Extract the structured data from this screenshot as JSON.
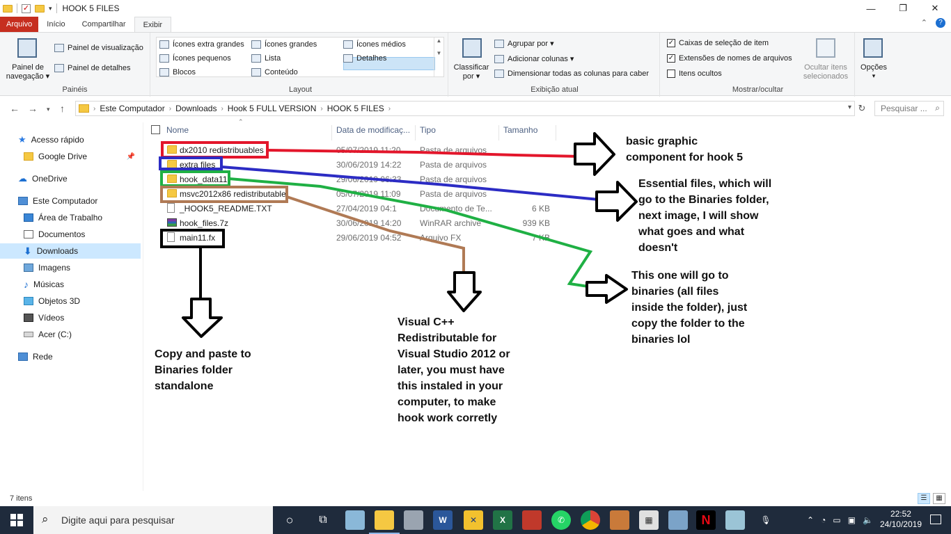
{
  "window": {
    "title": "HOOK 5 FILES",
    "controls": [
      "—",
      "❐",
      "✕"
    ]
  },
  "ribbon_tabs": [
    "Arquivo",
    "Início",
    "Compartilhar",
    "Exibir"
  ],
  "ribbon": {
    "paineis": {
      "label": "Painéis",
      "nav_pane": "Painel de\nnavegação ▾",
      "preview": "Painel de visualização",
      "details": "Painel de detalhes"
    },
    "layout": {
      "label": "Layout",
      "items": [
        "Ícones extra grandes",
        "Ícones grandes",
        "Ícones médios",
        "Ícones pequenos",
        "Lista",
        "Detalhes",
        "Blocos",
        "Conteúdo"
      ],
      "selected": "Detalhes"
    },
    "current_view": {
      "label": "Exibição atual",
      "sort": "Classificar\npor ▾",
      "group_by": "Agrupar por ▾",
      "add_columns": "Adicionar colunas ▾",
      "size_columns": "Dimensionar todas as colunas para caber"
    },
    "show_hide": {
      "label": "Mostrar/ocultar",
      "item_checkboxes": "Caixas de seleção de item",
      "extensions": "Extensões de nomes de arquivos",
      "hidden_items": "Itens ocultos",
      "hide_selected": "Ocultar itens\nselecionados",
      "options": "Opções"
    }
  },
  "address": {
    "crumbs": [
      "Este Computador",
      "Downloads",
      "Hook 5 FULL VERSION",
      "HOOK 5 FILES"
    ],
    "search_placeholder": "Pesquisar ..."
  },
  "nav_pane": {
    "items": [
      {
        "label": "Acesso rápido",
        "icon": "star-icon"
      },
      {
        "label": "Google Drive",
        "icon": "folder-icon"
      },
      {
        "label": "OneDrive",
        "icon": "cloud-icon"
      },
      {
        "label": "Este Computador",
        "icon": "computer-icon"
      },
      {
        "label": "Área de Trabalho",
        "icon": "desktop-icon"
      },
      {
        "label": "Documentos",
        "icon": "documents-icon"
      },
      {
        "label": "Downloads",
        "icon": "download-icon"
      },
      {
        "label": "Imagens",
        "icon": "images-icon"
      },
      {
        "label": "Músicas",
        "icon": "music-icon"
      },
      {
        "label": "Objetos 3D",
        "icon": "cube-icon"
      },
      {
        "label": "Vídeos",
        "icon": "video-icon"
      },
      {
        "label": "Acer (C:)",
        "icon": "drive-icon"
      },
      {
        "label": "Rede",
        "icon": "network-icon"
      }
    ],
    "selected": "Downloads"
  },
  "columns": [
    "Nome",
    "Data de modificaç...",
    "Tipo",
    "Tamanho"
  ],
  "files": [
    {
      "name": "dx2010 redistribuables",
      "date": "05/07/2019 11:20",
      "type": "Pasta de arquivos",
      "size": "",
      "kind": "folder"
    },
    {
      "name": "extra files",
      "date": "30/06/2019 14:22",
      "type": "Pasta de arquivos",
      "size": "",
      "kind": "folder"
    },
    {
      "name": "hook_data11",
      "date": "29/06/2019 06:33",
      "type": "Pasta de arquivos",
      "size": "",
      "kind": "folder"
    },
    {
      "name": "msvc2012x86 redistributable",
      "date": "05/07/2019 11:09",
      "type": "Pasta de arquivos",
      "size": "",
      "kind": "folder"
    },
    {
      "name": "_HOOK5_README.TXT",
      "date": "27/04/2019 04:1",
      "type": "Documento de Te...",
      "size": "6 KB",
      "kind": "doc"
    },
    {
      "name": "hook_files.7z",
      "date": "30/06/2019 14:20",
      "type": "WinRAR archive",
      "size": "939 KB",
      "kind": "rar"
    },
    {
      "name": "main11.fx",
      "date": "29/06/2019 04:52",
      "type": "Arquivo FX",
      "size": "7 KB",
      "kind": "doc"
    }
  ],
  "status": {
    "count": "7 itens"
  },
  "taskbar": {
    "search_placeholder": "Digite aqui para pesquisar",
    "time": "22:52",
    "date": "24/10/2019"
  },
  "annotations": {
    "graphic": "basic graphic\ncomponent for hook 5",
    "essential": "Essential files, which will\ngo to the Binaries folder,\nnext image, I will show\nwhat goes and what\ndoesn't",
    "binaries": "This one will go to\nbinaries (all files\ninside the folder), just\ncopy the folder to the\nbinaries lol",
    "vcpp": "Visual C++\nRedistributable for\nVisual Studio 2012 or\nlater, you must have\nthis instaled in your\ncomputer, to make\nhook work corretly",
    "copy": "Copy and paste to\nBinaries folder\nstandalone"
  },
  "colors": {
    "red": "#e3162b",
    "blue": "#2c2cc4",
    "green": "#1fb044",
    "brown": "#b07a55",
    "black": "#000000",
    "selection": "#cce8ff",
    "file_tab": "#c62e1f",
    "taskbar": "#1f2b3c"
  }
}
